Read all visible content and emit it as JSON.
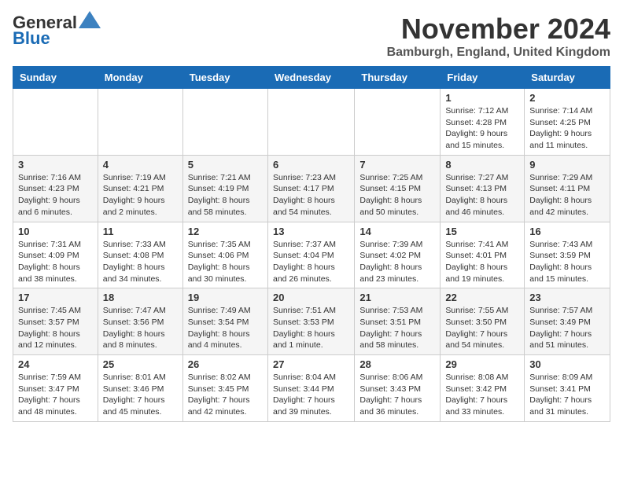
{
  "header": {
    "logo_general": "General",
    "logo_blue": "Blue",
    "month_title": "November 2024",
    "location": "Bamburgh, England, United Kingdom"
  },
  "days_of_week": [
    "Sunday",
    "Monday",
    "Tuesday",
    "Wednesday",
    "Thursday",
    "Friday",
    "Saturday"
  ],
  "weeks": [
    [
      null,
      null,
      null,
      null,
      null,
      {
        "day": "1",
        "sunrise": "Sunrise: 7:12 AM",
        "sunset": "Sunset: 4:28 PM",
        "daylight": "Daylight: 9 hours and 15 minutes."
      },
      {
        "day": "2",
        "sunrise": "Sunrise: 7:14 AM",
        "sunset": "Sunset: 4:25 PM",
        "daylight": "Daylight: 9 hours and 11 minutes."
      }
    ],
    [
      {
        "day": "3",
        "sunrise": "Sunrise: 7:16 AM",
        "sunset": "Sunset: 4:23 PM",
        "daylight": "Daylight: 9 hours and 6 minutes."
      },
      {
        "day": "4",
        "sunrise": "Sunrise: 7:19 AM",
        "sunset": "Sunset: 4:21 PM",
        "daylight": "Daylight: 9 hours and 2 minutes."
      },
      {
        "day": "5",
        "sunrise": "Sunrise: 7:21 AM",
        "sunset": "Sunset: 4:19 PM",
        "daylight": "Daylight: 8 hours and 58 minutes."
      },
      {
        "day": "6",
        "sunrise": "Sunrise: 7:23 AM",
        "sunset": "Sunset: 4:17 PM",
        "daylight": "Daylight: 8 hours and 54 minutes."
      },
      {
        "day": "7",
        "sunrise": "Sunrise: 7:25 AM",
        "sunset": "Sunset: 4:15 PM",
        "daylight": "Daylight: 8 hours and 50 minutes."
      },
      {
        "day": "8",
        "sunrise": "Sunrise: 7:27 AM",
        "sunset": "Sunset: 4:13 PM",
        "daylight": "Daylight: 8 hours and 46 minutes."
      },
      {
        "day": "9",
        "sunrise": "Sunrise: 7:29 AM",
        "sunset": "Sunset: 4:11 PM",
        "daylight": "Daylight: 8 hours and 42 minutes."
      }
    ],
    [
      {
        "day": "10",
        "sunrise": "Sunrise: 7:31 AM",
        "sunset": "Sunset: 4:09 PM",
        "daylight": "Daylight: 8 hours and 38 minutes."
      },
      {
        "day": "11",
        "sunrise": "Sunrise: 7:33 AM",
        "sunset": "Sunset: 4:08 PM",
        "daylight": "Daylight: 8 hours and 34 minutes."
      },
      {
        "day": "12",
        "sunrise": "Sunrise: 7:35 AM",
        "sunset": "Sunset: 4:06 PM",
        "daylight": "Daylight: 8 hours and 30 minutes."
      },
      {
        "day": "13",
        "sunrise": "Sunrise: 7:37 AM",
        "sunset": "Sunset: 4:04 PM",
        "daylight": "Daylight: 8 hours and 26 minutes."
      },
      {
        "day": "14",
        "sunrise": "Sunrise: 7:39 AM",
        "sunset": "Sunset: 4:02 PM",
        "daylight": "Daylight: 8 hours and 23 minutes."
      },
      {
        "day": "15",
        "sunrise": "Sunrise: 7:41 AM",
        "sunset": "Sunset: 4:01 PM",
        "daylight": "Daylight: 8 hours and 19 minutes."
      },
      {
        "day": "16",
        "sunrise": "Sunrise: 7:43 AM",
        "sunset": "Sunset: 3:59 PM",
        "daylight": "Daylight: 8 hours and 15 minutes."
      }
    ],
    [
      {
        "day": "17",
        "sunrise": "Sunrise: 7:45 AM",
        "sunset": "Sunset: 3:57 PM",
        "daylight": "Daylight: 8 hours and 12 minutes."
      },
      {
        "day": "18",
        "sunrise": "Sunrise: 7:47 AM",
        "sunset": "Sunset: 3:56 PM",
        "daylight": "Daylight: 8 hours and 8 minutes."
      },
      {
        "day": "19",
        "sunrise": "Sunrise: 7:49 AM",
        "sunset": "Sunset: 3:54 PM",
        "daylight": "Daylight: 8 hours and 4 minutes."
      },
      {
        "day": "20",
        "sunrise": "Sunrise: 7:51 AM",
        "sunset": "Sunset: 3:53 PM",
        "daylight": "Daylight: 8 hours and 1 minute."
      },
      {
        "day": "21",
        "sunrise": "Sunrise: 7:53 AM",
        "sunset": "Sunset: 3:51 PM",
        "daylight": "Daylight: 7 hours and 58 minutes."
      },
      {
        "day": "22",
        "sunrise": "Sunrise: 7:55 AM",
        "sunset": "Sunset: 3:50 PM",
        "daylight": "Daylight: 7 hours and 54 minutes."
      },
      {
        "day": "23",
        "sunrise": "Sunrise: 7:57 AM",
        "sunset": "Sunset: 3:49 PM",
        "daylight": "Daylight: 7 hours and 51 minutes."
      }
    ],
    [
      {
        "day": "24",
        "sunrise": "Sunrise: 7:59 AM",
        "sunset": "Sunset: 3:47 PM",
        "daylight": "Daylight: 7 hours and 48 minutes."
      },
      {
        "day": "25",
        "sunrise": "Sunrise: 8:01 AM",
        "sunset": "Sunset: 3:46 PM",
        "daylight": "Daylight: 7 hours and 45 minutes."
      },
      {
        "day": "26",
        "sunrise": "Sunrise: 8:02 AM",
        "sunset": "Sunset: 3:45 PM",
        "daylight": "Daylight: 7 hours and 42 minutes."
      },
      {
        "day": "27",
        "sunrise": "Sunrise: 8:04 AM",
        "sunset": "Sunset: 3:44 PM",
        "daylight": "Daylight: 7 hours and 39 minutes."
      },
      {
        "day": "28",
        "sunrise": "Sunrise: 8:06 AM",
        "sunset": "Sunset: 3:43 PM",
        "daylight": "Daylight: 7 hours and 36 minutes."
      },
      {
        "day": "29",
        "sunrise": "Sunrise: 8:08 AM",
        "sunset": "Sunset: 3:42 PM",
        "daylight": "Daylight: 7 hours and 33 minutes."
      },
      {
        "day": "30",
        "sunrise": "Sunrise: 8:09 AM",
        "sunset": "Sunset: 3:41 PM",
        "daylight": "Daylight: 7 hours and 31 minutes."
      }
    ]
  ]
}
